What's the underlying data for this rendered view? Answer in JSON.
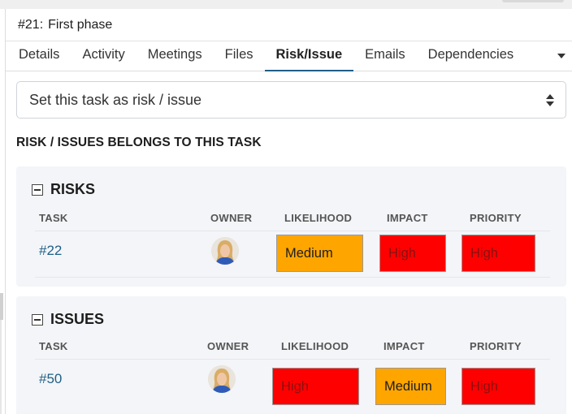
{
  "header": {
    "task_number": "#21:",
    "task_title": "First phase"
  },
  "tabs": [
    {
      "label": "Details"
    },
    {
      "label": "Activity"
    },
    {
      "label": "Meetings"
    },
    {
      "label": "Files"
    },
    {
      "label": "Risk/Issue",
      "active": true
    },
    {
      "label": "Emails"
    },
    {
      "label": "Dependencies"
    }
  ],
  "select": {
    "value": "Set this task as risk / issue"
  },
  "section_title": "RISK / ISSUES BELONGS TO THIS TASK",
  "columns": {
    "task": "TASK",
    "owner": "OWNER",
    "likelihood": "LIKELIHOOD",
    "impact": "IMPACT",
    "priority": "PRIORITY"
  },
  "risks": {
    "title": "RISKS",
    "rows": [
      {
        "task": "#22",
        "likelihood": "Medium",
        "impact": "High",
        "priority": "High"
      }
    ]
  },
  "issues": {
    "title": "ISSUES",
    "rows": [
      {
        "task": "#50",
        "likelihood": "High",
        "impact": "Medium",
        "priority": "High"
      }
    ]
  },
  "colors": {
    "high": "#ff0000",
    "medium": "#ffa500",
    "link": "#1f5f86",
    "active_tab_underline": "#1f5f86"
  }
}
